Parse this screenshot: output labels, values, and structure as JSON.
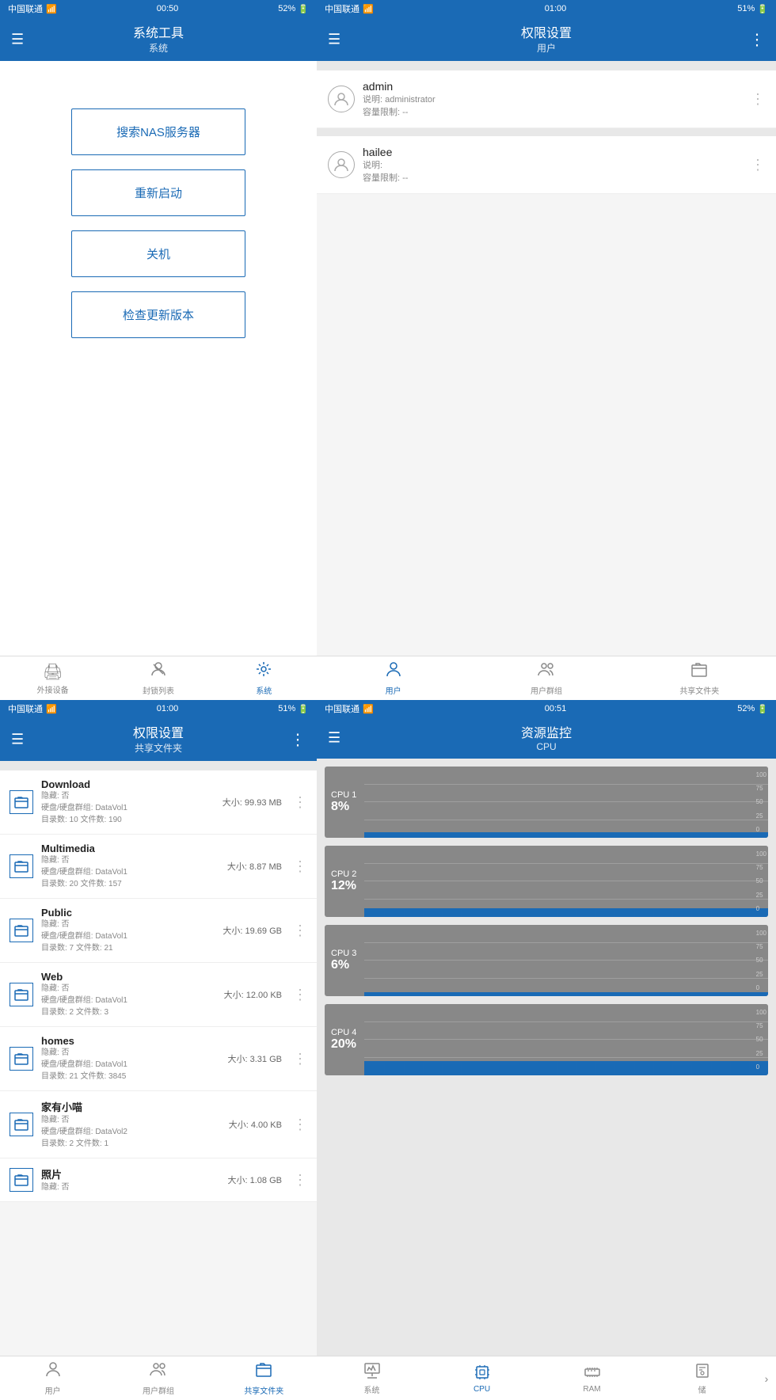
{
  "panel1": {
    "status": {
      "carrier": "中国联通",
      "time": "00:50",
      "battery": "52%"
    },
    "title": "系统工具",
    "subtitle": "系统",
    "buttons": [
      "搜索NAS服务器",
      "重新启动",
      "关机",
      "检查更新版本"
    ],
    "tabs": [
      {
        "label": "外接设备",
        "icon": "🖨"
      },
      {
        "label": "封锁列表",
        "icon": "👤"
      },
      {
        "label": "系统",
        "icon": "⚙",
        "active": true
      }
    ]
  },
  "panel2": {
    "status": {
      "carrier": "中国联通",
      "time": "01:00",
      "battery": "51%"
    },
    "title": "权限设置",
    "subtitle": "用户",
    "users": [
      {
        "name": "admin",
        "desc1": "说明: administrator",
        "desc2": "容量限制: --"
      },
      {
        "name": "hailee",
        "desc1": "说明:",
        "desc2": "容量限制: --"
      }
    ],
    "tabs": [
      {
        "label": "用户",
        "icon": "👤",
        "active": true
      },
      {
        "label": "用户群组",
        "icon": "👥"
      },
      {
        "label": "共享文件夹",
        "icon": "📂"
      }
    ]
  },
  "panel3": {
    "status": {
      "carrier": "中国联通",
      "time": "01:00",
      "battery": "51%"
    },
    "title": "权限设置",
    "subtitle": "共享文件夹",
    "shares": [
      {
        "name": "Download",
        "hidden": "隐藏: 否",
        "disk": "硬盘/硬盘群组: DataVol1",
        "dirs": "目录数: 10 文件数: 190",
        "size": "大小: 99.93 MB"
      },
      {
        "name": "Multimedia",
        "hidden": "隐藏: 否",
        "disk": "硬盘/硬盘群组: DataVol1",
        "dirs": "目录数: 20 文件数: 157",
        "size": "大小: 8.87 MB"
      },
      {
        "name": "Public",
        "hidden": "隐藏: 否",
        "disk": "硬盘/硬盘群组: DataVol1",
        "dirs": "目录数: 7 文件数: 21",
        "size": "大小: 19.69 GB"
      },
      {
        "name": "Web",
        "hidden": "隐藏: 否",
        "disk": "硬盘/硬盘群组: DataVol1",
        "dirs": "目录数: 2 文件数: 3",
        "size": "大小: 12.00 KB"
      },
      {
        "name": "homes",
        "hidden": "隐藏: 否",
        "disk": "硬盘/硬盘群组: DataVol1",
        "dirs": "目录数: 21 文件数: 3845",
        "size": "大小: 3.31 GB"
      },
      {
        "name": "家有小喵",
        "hidden": "隐藏: 否",
        "disk": "硬盘/硬盘群组: DataVol2",
        "dirs": "目录数: 2 文件数: 1",
        "size": "大小: 4.00 KB"
      },
      {
        "name": "照片",
        "hidden": "隐藏: 否",
        "disk": "",
        "dirs": "",
        "size": "大小: 1.08 GB"
      }
    ],
    "tabs": [
      {
        "label": "用户",
        "icon": "👤"
      },
      {
        "label": "用户群组",
        "icon": "👥"
      },
      {
        "label": "共享文件夹",
        "icon": "📂",
        "active": true
      }
    ]
  },
  "panel4": {
    "status": {
      "carrier": "中国联通",
      "time": "00:51",
      "battery": "52%"
    },
    "title": "资源监控",
    "subtitle": "CPU",
    "cpus": [
      {
        "label": "CPU 1",
        "pct": "8%",
        "value": 8,
        "bars": [
          5,
          7,
          4,
          8,
          6,
          5,
          8,
          7,
          4,
          6,
          8,
          5,
          7,
          6,
          8,
          5,
          4,
          7,
          8,
          6
        ]
      },
      {
        "label": "CPU 2",
        "pct": "12%",
        "value": 12,
        "bars": [
          8,
          10,
          12,
          9,
          11,
          10,
          12,
          8,
          9,
          11,
          10,
          12,
          9,
          10,
          11,
          12,
          8,
          10,
          11,
          12
        ]
      },
      {
        "label": "CPU 3",
        "pct": "6%",
        "value": 6,
        "bars": [
          4,
          5,
          6,
          5,
          4,
          6,
          5,
          4,
          5,
          6,
          4,
          5,
          6,
          5,
          4,
          6,
          5,
          4,
          5,
          6
        ]
      },
      {
        "label": "CPU 4",
        "pct": "20%",
        "value": 20,
        "bars": [
          15,
          18,
          20,
          17,
          16,
          18,
          20,
          15,
          17,
          19,
          18,
          20,
          16,
          17,
          19,
          20,
          15,
          18,
          19,
          20
        ]
      }
    ],
    "yLabels": [
      "100",
      "75",
      "50",
      "25",
      "0"
    ],
    "tabs": [
      {
        "label": "系统",
        "icon": "📊"
      },
      {
        "label": "CPU",
        "icon": "📈",
        "active": true
      },
      {
        "label": "RAM",
        "icon": "💾"
      },
      {
        "label": "储",
        "icon": "💿"
      }
    ]
  }
}
